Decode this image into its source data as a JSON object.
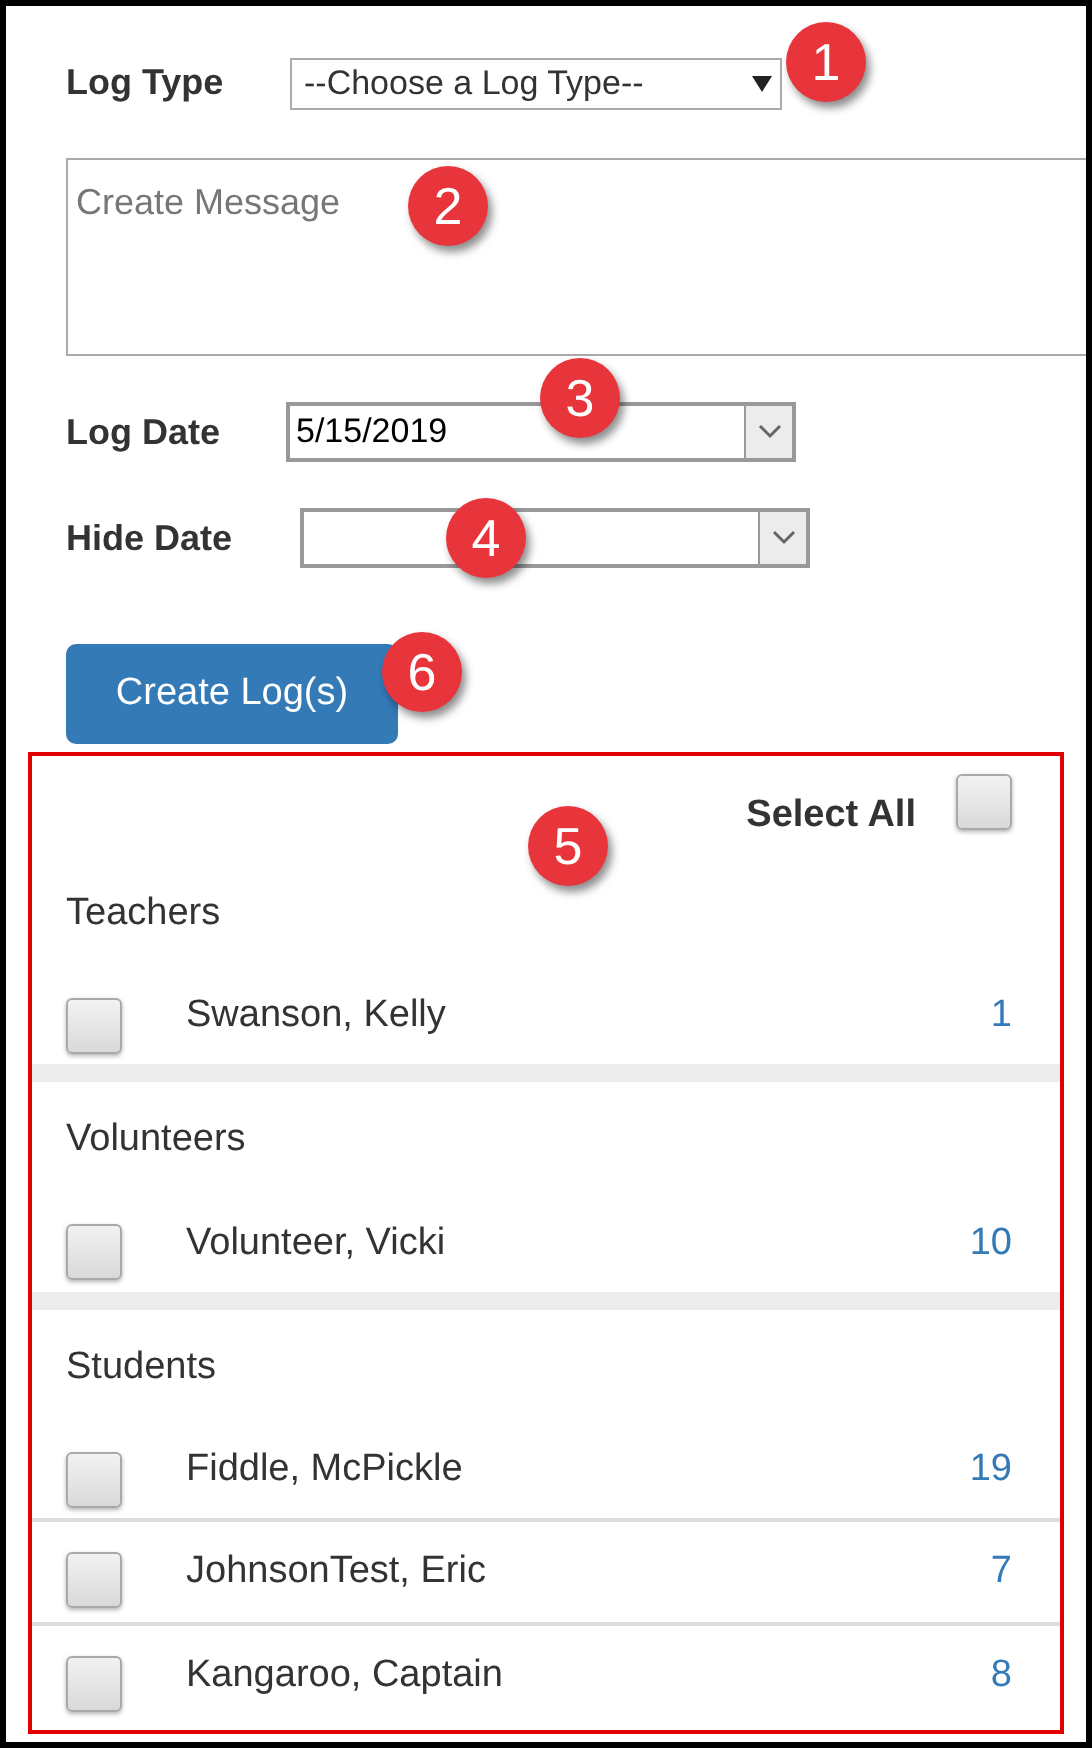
{
  "log_type": {
    "label": "Log Type",
    "value": "--Choose a Log Type--",
    "callout": "1"
  },
  "message": {
    "placeholder": "Create Message",
    "callout": "2"
  },
  "log_date": {
    "label": "Log Date",
    "value": "5/15/2019",
    "callout": "3"
  },
  "hide_date": {
    "label": "Hide Date",
    "callout": "4"
  },
  "create_button": {
    "label": "Create Log(s)",
    "callout": "6"
  },
  "recipients": {
    "callout": "5",
    "select_all": {
      "label": "Select All",
      "checked": false
    },
    "groups": [
      {
        "name": "Teachers",
        "members": [
          {
            "name": "Swanson, Kelly",
            "count": "1",
            "checked": false
          }
        ]
      },
      {
        "name": "Volunteers",
        "members": [
          {
            "name": "Volunteer, Vicki",
            "count": "10",
            "checked": false
          }
        ]
      },
      {
        "name": "Students",
        "members": [
          {
            "name": "Fiddle, McPickle",
            "count": "19",
            "checked": false
          },
          {
            "name": "JohnsonTest, Eric",
            "count": "7",
            "checked": false
          },
          {
            "name": "Kangaroo, Captain",
            "count": "8",
            "checked": false
          }
        ]
      }
    ]
  }
}
